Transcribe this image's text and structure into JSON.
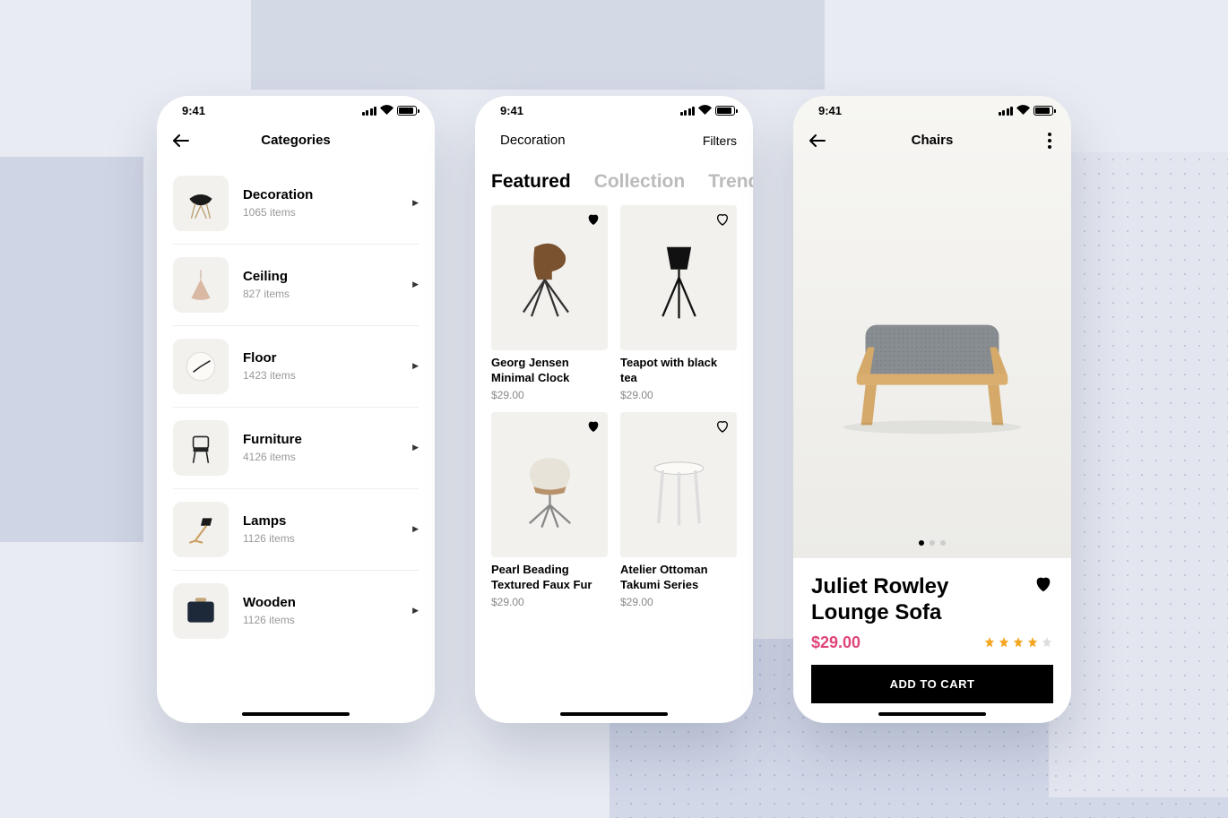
{
  "status": {
    "time": "9:41"
  },
  "screen1": {
    "title": "Categories",
    "items": [
      {
        "name": "Decoration",
        "count": "1065 items"
      },
      {
        "name": "Ceiling",
        "count": "827 items"
      },
      {
        "name": "Floor",
        "count": "1423 items"
      },
      {
        "name": "Furniture",
        "count": "4126 items"
      },
      {
        "name": "Lamps",
        "count": "1126 items"
      },
      {
        "name": "Wooden",
        "count": "1126 items"
      }
    ]
  },
  "screen2": {
    "title": "Decoration",
    "filters_label": "Filters",
    "tabs": [
      "Featured",
      "Collection",
      "Trend"
    ],
    "active_tab": 0,
    "products": [
      {
        "name": "Georg Jensen Minimal Clock",
        "price": "$29.00",
        "fav": true
      },
      {
        "name": "Teapot with black tea",
        "price": "$29.00",
        "fav": false
      },
      {
        "name": "Pearl Beading Textured Faux Fur",
        "price": "$29.00",
        "fav": true
      },
      {
        "name": "Atelier Ottoman Takumi Series",
        "price": "$29.00",
        "fav": false
      }
    ]
  },
  "screen3": {
    "title": "Chairs",
    "product_name": "Juliet Rowley Lounge Sofa",
    "price": "$29.00",
    "rating": 4,
    "add_label": "ADD TO CART",
    "image_index": 0,
    "image_count": 3
  }
}
